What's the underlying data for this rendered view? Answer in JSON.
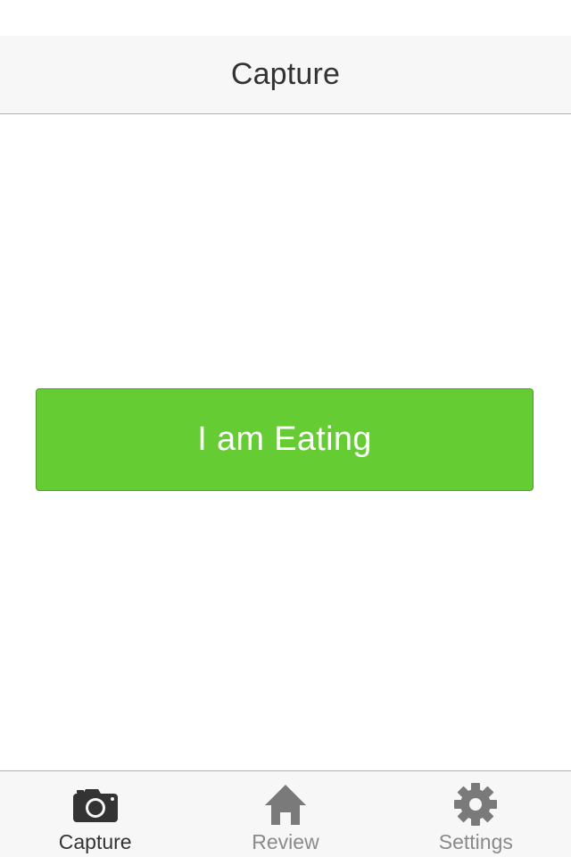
{
  "nav": {
    "title": "Capture"
  },
  "main": {
    "action_button_label": "I am Eating",
    "action_button_color": "#66cc33"
  },
  "tabbar": {
    "active_tab": "Capture",
    "tabs": [
      {
        "label": "Capture",
        "icon": "camera-icon",
        "active": true
      },
      {
        "label": "Review",
        "icon": "home-icon",
        "active": false
      },
      {
        "label": "Settings",
        "icon": "gear-icon",
        "active": false
      }
    ]
  },
  "colors": {
    "active_icon": "#333333",
    "inactive_icon": "#7a7a7a",
    "bar_background": "#f7f7f7"
  }
}
